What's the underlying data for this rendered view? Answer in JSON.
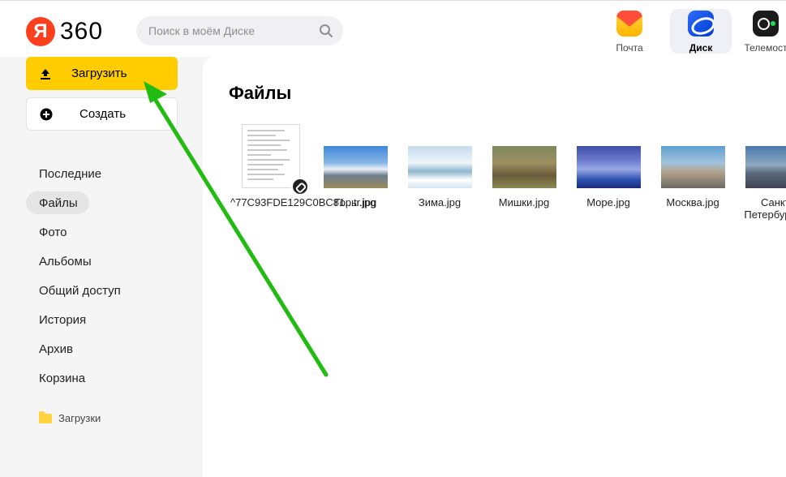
{
  "header": {
    "logo": {
      "ya": "Я",
      "text": "360"
    },
    "search": {
      "placeholder": "Поиск в моём Диске"
    },
    "services": [
      {
        "label": "Почта",
        "icon": "mail-icon"
      },
      {
        "label": "Диск",
        "icon": "disk-icon",
        "active": true
      },
      {
        "label": "Телемост",
        "icon": "telemost-icon"
      }
    ]
  },
  "sidebar": {
    "upload_label": "Загрузить",
    "create_label": "Создать",
    "items": [
      {
        "label": "Последние"
      },
      {
        "label": "Файлы",
        "active": true
      },
      {
        "label": "Фото"
      },
      {
        "label": "Альбомы"
      },
      {
        "label": "Общий доступ"
      },
      {
        "label": "История"
      },
      {
        "label": "Архив"
      },
      {
        "label": "Корзина"
      }
    ],
    "folder": "Загрузки"
  },
  "main": {
    "title": "Файлы",
    "files": [
      {
        "name": "^77C93FDE129C0BC81...tr.jpg",
        "thumb": "document",
        "shared": true
      },
      {
        "name": "Горы.jpg",
        "thumb": "mountains"
      },
      {
        "name": "Зима.jpg",
        "thumb": "winter"
      },
      {
        "name": "Мишки.jpg",
        "thumb": "bears"
      },
      {
        "name": "Море.jpg",
        "thumb": "sea"
      },
      {
        "name": "Москва.jpg",
        "thumb": "moscow"
      },
      {
        "name": "Санкт-Петербург.jpg",
        "thumb": "spb"
      }
    ]
  },
  "colors": {
    "accent_yellow": "#ffcc00",
    "logo_red": "#fc3f1d",
    "annotation_arrow": "#22bb11"
  }
}
